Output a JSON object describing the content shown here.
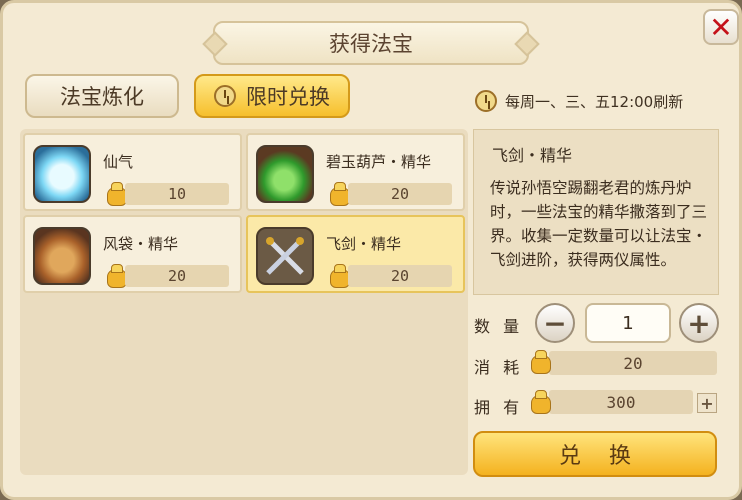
{
  "dialog": {
    "title": "获得法宝",
    "close": "✕"
  },
  "tabs": [
    {
      "label": "法宝炼化",
      "active": false
    },
    {
      "label": "限时兑换",
      "active": true
    }
  ],
  "refresh_text": "每周一、三、五12:00刷新",
  "items": [
    {
      "name": "仙气",
      "cost": "10",
      "icon": "cloud-spirit-icon",
      "selected": false
    },
    {
      "name": "碧玉葫芦・精华",
      "cost": "20",
      "icon": "jade-gourd-icon",
      "selected": false
    },
    {
      "name": "风袋・精华",
      "cost": "20",
      "icon": "wind-bag-icon",
      "selected": false
    },
    {
      "name": "飞剑・精华",
      "cost": "20",
      "icon": "flying-sword-icon",
      "selected": true
    }
  ],
  "detail": {
    "title": "飞剑・精华",
    "description": "传说孙悟空踢翻老君的炼丹炉时，一些法宝的精华撒落到了三界。收集一定数量可以让法宝・飞剑进阶，获得两仪属性。"
  },
  "quantity": {
    "label": "数 量",
    "value": "1",
    "minus": "−",
    "plus": "+"
  },
  "consume": {
    "label": "消 耗",
    "value": "20"
  },
  "owned": {
    "label": "拥 有",
    "value": "300",
    "plus": "+"
  },
  "exchange_button": "兑换"
}
